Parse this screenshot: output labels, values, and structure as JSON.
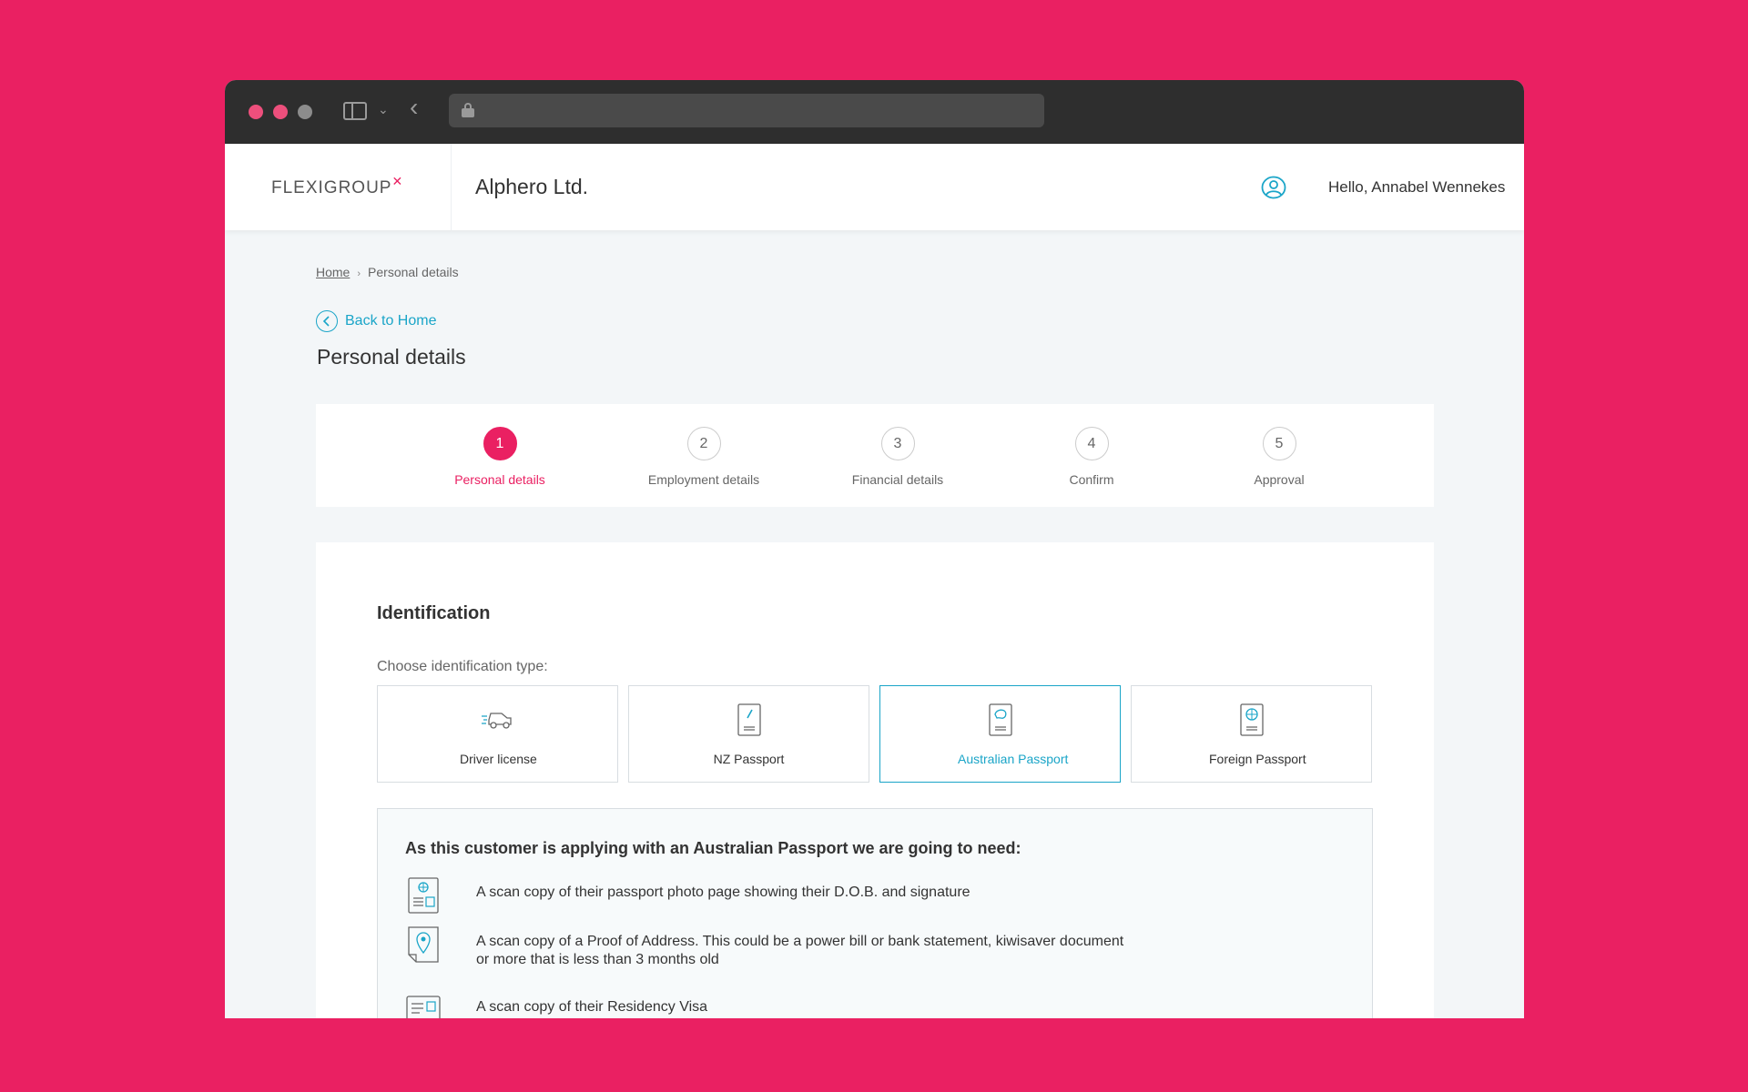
{
  "app": {
    "brand": "FLEXIGROUP",
    "company": "Alphero Ltd.",
    "greeting": "Hello, Annabel Wennekes"
  },
  "breadcrumb": {
    "home": "Home",
    "current": "Personal details"
  },
  "back_link": "Back to Home",
  "page_title": "Personal details",
  "steps": [
    {
      "num": "1",
      "label": "Personal details",
      "active": true
    },
    {
      "num": "2",
      "label": "Employment details",
      "active": false
    },
    {
      "num": "3",
      "label": "Financial details",
      "active": false
    },
    {
      "num": "4",
      "label": "Confirm",
      "active": false
    },
    {
      "num": "5",
      "label": "Approval",
      "active": false
    }
  ],
  "identification": {
    "title": "Identification",
    "choose_label": "Choose identification type:",
    "options": [
      {
        "label": "Driver license",
        "icon": "car-icon",
        "selected": false
      },
      {
        "label": "NZ Passport",
        "icon": "nz-passport-icon",
        "selected": false
      },
      {
        "label": "Australian Passport",
        "icon": "australian-passport-icon",
        "selected": true
      },
      {
        "label": "Foreign Passport",
        "icon": "foreign-passport-icon",
        "selected": false
      }
    ]
  },
  "requirements": {
    "title": "As this customer is applying with an Australian Passport we are going to need:",
    "items": [
      {
        "text": "A scan copy of their passport photo page showing their D.O.B. and signature",
        "icon": "passport-scan-icon"
      },
      {
        "text": "A scan copy of a Proof of Address. This could be a power bill or bank statement, kiwisaver document or more that is less than 3 months old",
        "icon": "proof-of-address-icon"
      },
      {
        "text": "A scan copy of their Residency Visa",
        "icon": "residency-visa-icon"
      }
    ]
  },
  "colors": {
    "accent": "#ea2062",
    "link": "#1aa5c8"
  }
}
